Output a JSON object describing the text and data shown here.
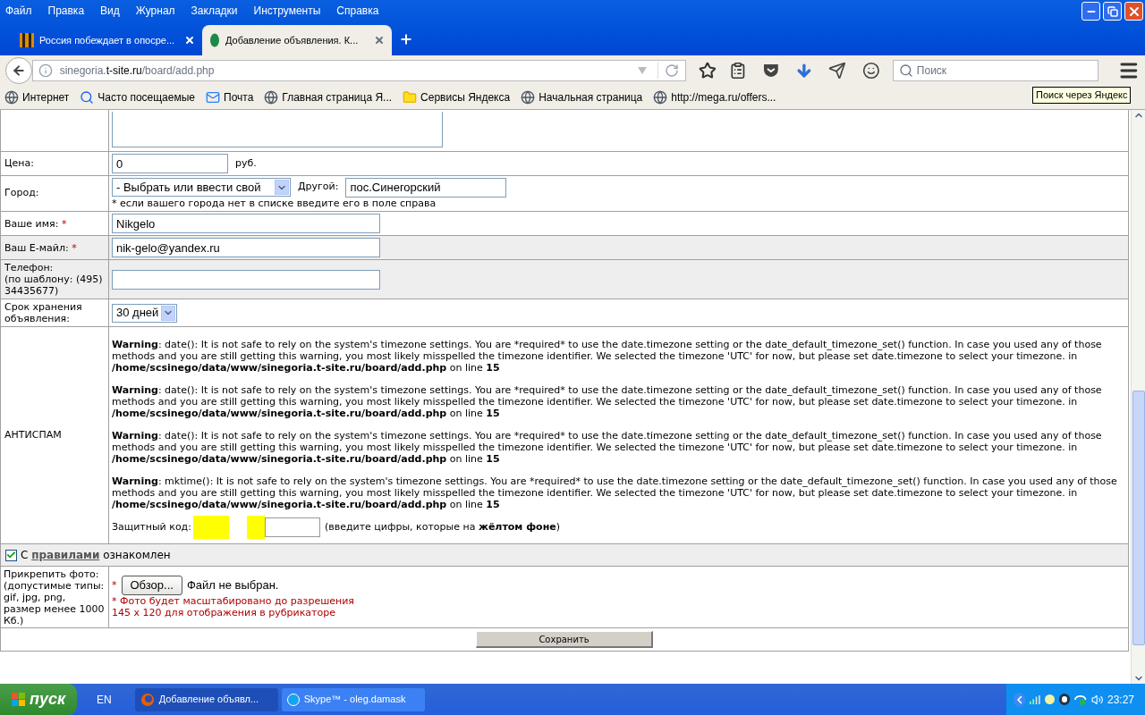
{
  "menu": [
    "Файл",
    "Правка",
    "Вид",
    "Журнал",
    "Закладки",
    "Инструменты",
    "Справка"
  ],
  "tabs": [
    {
      "title": "Россия побеждает в опосре...",
      "selected": false
    },
    {
      "title": "Добавление объявления. К...",
      "selected": true
    }
  ],
  "address": {
    "prefix": "sinegoria.",
    "domain": "t-site.ru",
    "path": "/board/add.php"
  },
  "search": {
    "placeholder": "Поиск"
  },
  "tooltip": "Поиск через Яндекс",
  "bookmarks": [
    {
      "label": "Интернет",
      "kind": "globe"
    },
    {
      "label": "Часто посещаемые",
      "kind": "search"
    },
    {
      "label": "Почта",
      "kind": "mail"
    },
    {
      "label": "Главная страница Я...",
      "kind": "globe"
    },
    {
      "label": "Сервисы Яндекса",
      "kind": "folder"
    },
    {
      "label": "Начальная страница",
      "kind": "globe"
    },
    {
      "label": "http://mega.ru/offers...",
      "kind": "globe"
    }
  ],
  "rows": [
    {
      "kind": "textarea"
    },
    {
      "kind": "price",
      "label": "Цена:",
      "value": "0",
      "unit": "руб."
    },
    {
      "kind": "city",
      "label": "Город:",
      "select": "- Выбрать или ввести свой",
      "other_label": "Другой:",
      "other_value": "пос.Синегорский",
      "hint": "* если вашего города нет в списке введите его в поле справа"
    },
    {
      "kind": "text",
      "label": "Ваше имя:",
      "required_mark": "*",
      "value": "Nikgelo",
      "shaded": false
    },
    {
      "kind": "text",
      "label": "Ваш E-майл:",
      "required_mark": "*",
      "value": "nik-gelo@yandex.ru",
      "shaded": true
    },
    {
      "kind": "text",
      "label": "Телефон:",
      "note": "(по шаблону: (495) 34435677)",
      "shaded": true
    },
    {
      "kind": "select",
      "label": "Срок хранения объявления:",
      "value": "30 дней"
    },
    {
      "kind": "antispam",
      "label": "АНТИСПАМ",
      "warnings": [
        {
          "level": "Warning",
          "message": ": date(): It is not safe to rely on the system's timezone settings. You are *required* to use the date.timezone setting or the date_default_timezone_set() function. In case you used any of those methods and you are still getting this warning, you most likely misspelled the timezone identifier. We selected the timezone 'UTC' for now, but please set date.timezone to select your timezone. in",
          "file": "/home/scsinego/data/www/sinegoria.t-site.ru/board/add.php",
          "line_label": "on line",
          "line": "15"
        },
        {
          "level": "Warning",
          "message": ": date(): It is not safe to rely on the system's timezone settings. You are *required* to use the date.timezone setting or the date_default_timezone_set() function. In case you used any of those methods and you are still getting this warning, you most likely misspelled the timezone identifier. We selected the timezone 'UTC' for now, but please set date.timezone to select your timezone. in",
          "file": "/home/scsinego/data/www/sinegoria.t-site.ru/board/add.php",
          "line_label": "on line",
          "line": "15"
        },
        {
          "level": "Warning",
          "message": ": date(): It is not safe to rely on the system's timezone settings. You are *required* to use the date.timezone setting or the date_default_timezone_set() function. In case you used any of those methods and you are still getting this warning, you most likely misspelled the timezone identifier. We selected the timezone 'UTC' for now, but please set date.timezone to select your timezone. in",
          "file": "/home/scsinego/data/www/sinegoria.t-site.ru/board/add.php",
          "line_label": "on line",
          "line": "15"
        },
        {
          "level": "Warning",
          "message": ": mktime(): It is not safe to rely on the system's timezone settings. You are *required* to use the date.timezone setting or the date_default_timezone_set() function. In case you used any of those methods and you are still getting this warning, you most likely misspelled the timezone identifier. We selected the timezone 'UTC' for now, but please set date.timezone to select your timezone. in",
          "file": "/home/scsinego/data/www/sinegoria.t-site.ru/board/add.php",
          "line_label": "on line",
          "line": "15"
        }
      ],
      "code_label": "Защитный код:",
      "code_hint": "(введите цифры, которые на **жёлтом фоне**)"
    }
  ],
  "rules": {
    "checked": true,
    "before": "С",
    "link": "правилами",
    "after": "ознакомлен"
  },
  "photo": {
    "label": "Прикрепить фото:",
    "note": "(допустимые типы: gif, jpg, png, размер менее 1000 Кб.)",
    "required_mark": "*",
    "button": "Обзор...",
    "status": "Файл не выбран.",
    "hint": [
      "* Фото будет масштабировано до разрешения",
      "145 х 120 для отображения в рубрикаторе"
    ]
  },
  "save": "Сохранить",
  "taskbar": {
    "start": "пуск",
    "lang": "EN",
    "tasks": [
      {
        "title": "Добавление объявл...",
        "kind": "firefox",
        "selected": true
      },
      {
        "title": "Skype™ - oleg.damask",
        "kind": "skype",
        "selected": false
      }
    ],
    "clock": "23:27"
  }
}
